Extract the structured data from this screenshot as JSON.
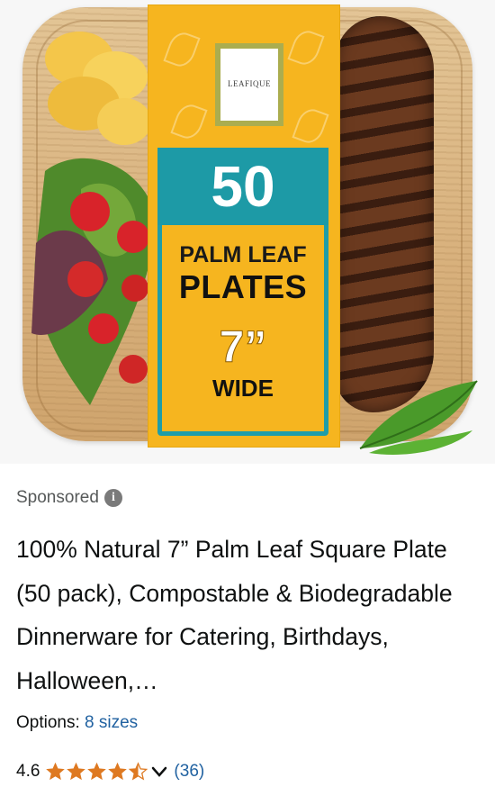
{
  "product_image": {
    "brand_logo_text": "LEAFIQUE",
    "count": "50",
    "line1": "PALM LEAF",
    "line2": "PLATES",
    "size": "7”",
    "size_word": "WIDE"
  },
  "listing": {
    "sponsored_label": "Sponsored",
    "info_icon": "i",
    "title": "100% Natural 7” Palm Leaf Square Plate (50 pack), Compostable & Biodegradable Dinnerware for Catering, Birthdays, Halloween,…",
    "options_label": "Options:",
    "options_value": "8 sizes",
    "rating": "4.6",
    "rating_fraction": 0.92,
    "review_count": "(36)"
  },
  "colors": {
    "link": "#2162a1",
    "star": "#de7921",
    "box_yellow": "#f6b51f",
    "box_teal": "#1d9aa6"
  },
  "icons": [
    "info-icon",
    "star-icon",
    "half-star-icon",
    "chevron-down-icon"
  ]
}
